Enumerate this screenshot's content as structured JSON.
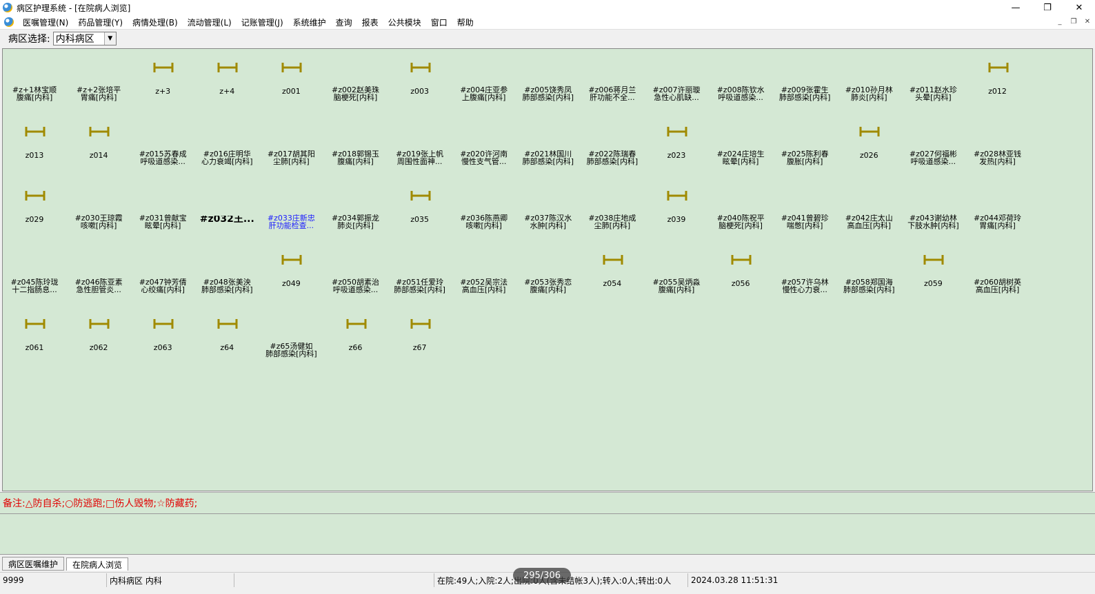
{
  "window": {
    "title": "病区护理系统 - [在院病人浏览]",
    "minimize": "—",
    "restore": "❐",
    "close": "✕"
  },
  "menu": [
    "医嘱管理(N)",
    "药品管理(Y)",
    "病情处理(B)",
    "流动管理(L)",
    "记账管理(J)",
    "系统维护",
    "查询",
    "报表",
    "公共模块",
    "窗口",
    "帮助"
  ],
  "mdi": {
    "minimize": "_",
    "restore": "❐",
    "close": "✕"
  },
  "toolbar": {
    "ward_label": "病区选择:",
    "ward_value": "内科病区"
  },
  "beds": [
    [
      "#z+1林宝顺\n腹痛[内科]",
      "#z+2张培平\n胃痛[内科]",
      "z+3",
      "z+4",
      "z001",
      "#z002赵美珠\n脑梗死[内科]",
      "z003",
      "#z004庄亚参\n上腹痛[内科]",
      "#z005饶秀凤\n肺部感染[内科]",
      "#z006蒋月兰\n肝功能不全...",
      "#z007许丽璇\n急性心肌缺...",
      "#z008陈钦水\n呼吸道感染...",
      "#z009张霍生\n肺部感染[内科]",
      "#z010孙月林\n肺炎[内科]",
      "#z011赵水珍\n头晕[内科]",
      "z012"
    ],
    [
      "z013",
      "z014",
      "#z015苏春成\n呼吸道感染...",
      "#z016庄明华\n心力衰竭[内科]",
      "#z017胡其阳\n尘肺[内科]",
      "#z018郭锡玉\n腹痛[内科]",
      "#z019张上帆\n周围性面神...",
      "#z020许河南\n慢性支气管...",
      "#z021林国川\n肺部感染[内科]",
      "#z022陈瑞春\n肺部感染[内科]",
      "z023",
      "#z024庄培生\n眩晕[内科]",
      "#z025陈利春\n腹胀[内科]",
      "z026",
      "#z027何福彬\n呼吸道感染...",
      "#z028林亚钱\n发热[内科]"
    ],
    [
      "z029",
      "#z030王琼霞\n咳嗽[内科]",
      "#z031曾献宝\n眩晕[内科]",
      "#z032王...",
      "#z033庄新忠\n肝功能检查...",
      "#z034郭振龙\n肺炎[内科]",
      "z035",
      "#z036陈燕卿\n咳嗽[内科]",
      "#z037陈汉水\n水肿[内科]",
      "#z038庄地成\n尘肺[内科]",
      "z039",
      "#z040陈祝平\n脑梗死[内科]",
      "#z041曾碧珍\n喘憋[内科]",
      "#z042庄太山\n高血压[内科]",
      "#z043谢幼林\n下肢水肿[内科]",
      "#z044邓荷玲\n胃痛[内科]"
    ],
    [
      "#z045陈玲珑\n十二指肠息...",
      "#z046陈亚素\n急性胆管炎...",
      "#z047钟芳倩\n心绞痛[内科]",
      "#z048张美泱\n肺部感染[内科]",
      "z049",
      "#z050胡素治\n呼吸道感染...",
      "#z051任爱玲\n肺部感染[内科]",
      "#z052吴宗法\n高血压[内科]",
      "#z053张秀恋\n腹痛[内科]",
      "z054",
      "#z055吴炳淼\n腹痛[内科]",
      "z056",
      "#z057许乌林\n慢性心力衰...",
      "#z058郑国海\n肺部感染[内科]",
      "z059",
      "#z060胡树英\n高血压[内科]"
    ],
    [
      "z061",
      "z062",
      "z063",
      "z64",
      "#z65汤健如\n肺部感染[内科]",
      "z66",
      "z67"
    ]
  ],
  "special_beds": {
    "bold": "#z032王...",
    "blue": "#z033庄新忠\n肝功能检查..."
  },
  "legend": "备注:△防自杀;○防逃跑;□伤人毁物;☆防藏药;",
  "tabs": [
    "病区医嘱维护",
    "在院病人浏览"
  ],
  "status": {
    "user": "9999",
    "ward": "内科病区 内科",
    "blank": "",
    "counts": "在院:49人;入院:2人;出院:0人(含未结帐3人);转入:0人;转出:0人",
    "datetime": "2024.03.28 11:51:31"
  },
  "page_indicator": "295/306",
  "colors": {
    "panel_bg": "#d4e8d4",
    "bed_icon": "#a08a00",
    "legend_text": "#e00000",
    "highlight_text": "#1a1aff"
  },
  "icons": {
    "bed": "bed-icon",
    "app": "app-logo-icon",
    "dropdown": "chevron-down-icon"
  }
}
